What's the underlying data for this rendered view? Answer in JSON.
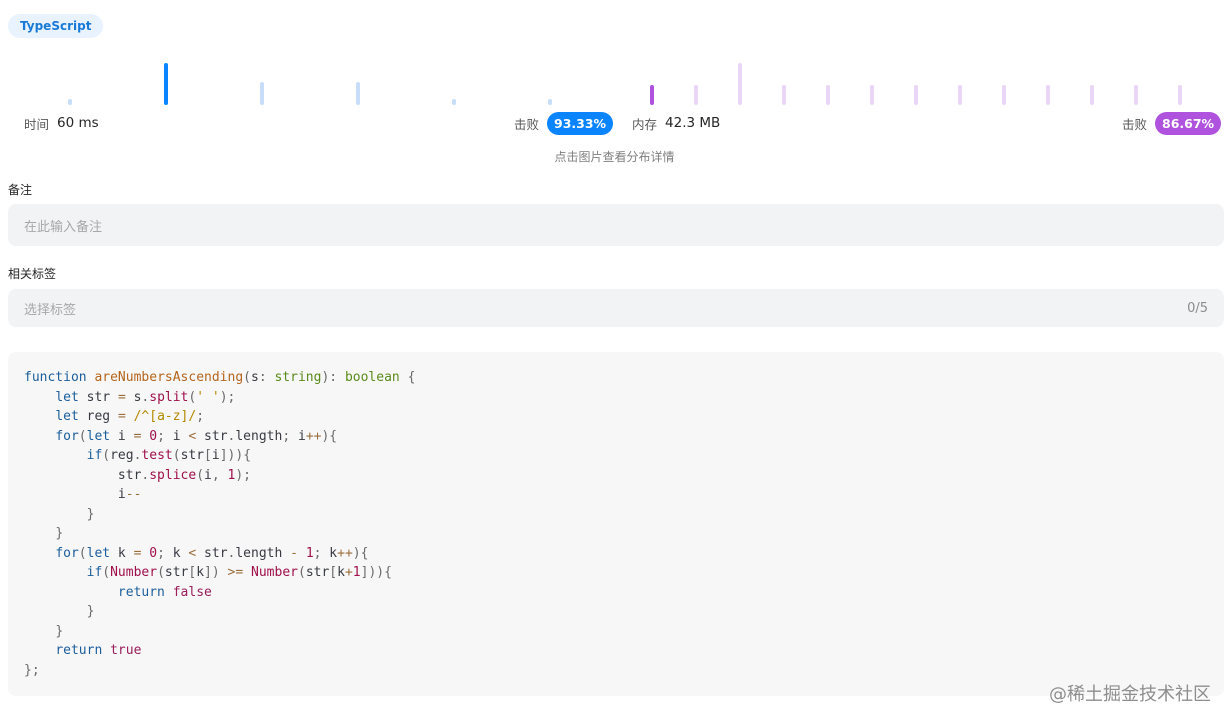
{
  "language_tag": "TypeScript",
  "runtime": {
    "label": "时间",
    "value": "60 ms",
    "beats_label": "击败",
    "beats_value": "93.33%"
  },
  "memory": {
    "label": "内存",
    "value": "42.3 MB",
    "beats_label": "击败",
    "beats_value": "86.67%"
  },
  "distribution_hint": "点击图片查看分布详情",
  "runtime_distribution": [
    {
      "level": 0.12,
      "highlight": false
    },
    {
      "level": 1.0,
      "highlight": true
    },
    {
      "level": 0.55,
      "highlight": false
    },
    {
      "level": 0.55,
      "highlight": false
    },
    {
      "level": 0.12,
      "highlight": false
    },
    {
      "level": 0.12,
      "highlight": false
    }
  ],
  "memory_distribution": [
    {
      "level": 0.48,
      "highlight": true
    },
    {
      "level": 0.48,
      "highlight": false
    },
    {
      "level": 1.0,
      "highlight": false
    },
    {
      "level": 0.48,
      "highlight": false
    },
    {
      "level": 0.48,
      "highlight": false
    },
    {
      "level": 0.48,
      "highlight": false
    },
    {
      "level": 0.48,
      "highlight": false
    },
    {
      "level": 0.48,
      "highlight": false
    },
    {
      "level": 0.48,
      "highlight": false
    },
    {
      "level": 0.48,
      "highlight": false
    },
    {
      "level": 0.48,
      "highlight": false
    },
    {
      "level": 0.48,
      "highlight": false
    },
    {
      "level": 0.48,
      "highlight": false
    }
  ],
  "colors": {
    "runtime_highlight": "#0a84ff",
    "runtime_bar": "#c7ddfa",
    "memory_highlight": "#af52de",
    "memory_bar": "#ead7f5"
  },
  "notes": {
    "label": "备注",
    "placeholder": "在此输入备注"
  },
  "tags": {
    "label": "相关标签",
    "placeholder": "选择标签",
    "counter": "0/5"
  },
  "code": [
    "function areNumbersAscending(s: string): boolean {",
    "    let str = s.split(' ');",
    "    let reg = /^[a-z]/;",
    "    for(let i = 0; i < str.length; i++){",
    "        if(reg.test(str[i])){",
    "            str.splice(i, 1);",
    "            i--",
    "        }",
    "    }",
    "    for(let k = 0; k < str.length - 1; k++){",
    "        if(Number(str[k]) >= Number(str[k+1])){",
    "            return false",
    "        }",
    "    }",
    "    return true",
    "};"
  ],
  "watermark": "@稀土掘金技术社区"
}
